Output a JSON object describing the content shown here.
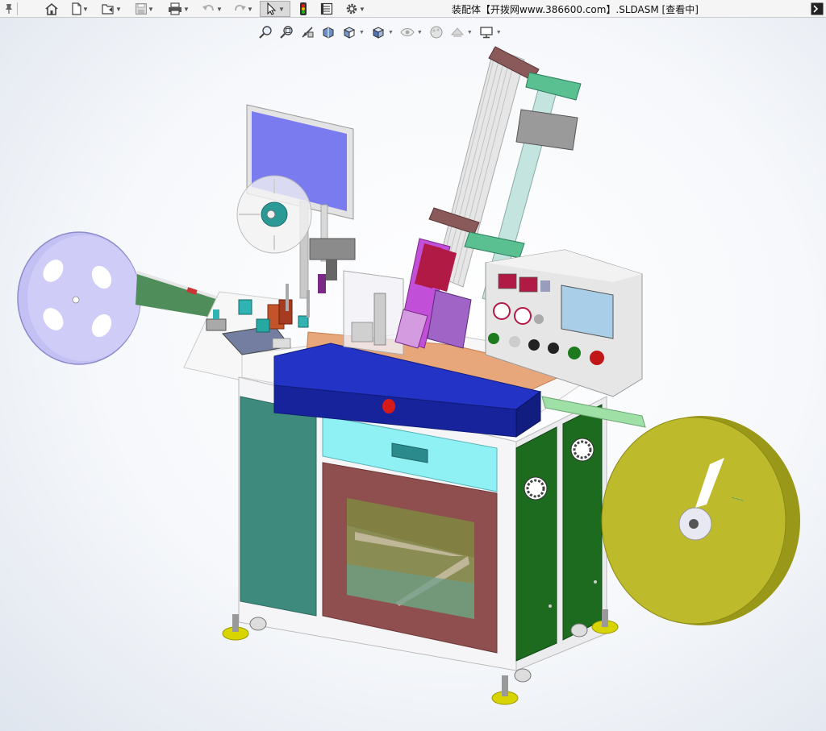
{
  "window": {
    "title": "装配体【开拨网www.386600.com】.SLDASM [查看中]",
    "right_button": ">_"
  },
  "toolbar": {
    "items": [
      {
        "icon": "pin-icon"
      },
      {
        "icon": "home-icon"
      },
      {
        "icon": "new-document-icon"
      },
      {
        "icon": "open-icon"
      },
      {
        "icon": "save-icon"
      },
      {
        "icon": "print-icon"
      },
      {
        "icon": "undo-icon"
      },
      {
        "icon": "redo-icon"
      },
      {
        "icon": "select-pointer-icon"
      },
      {
        "icon": "rebuild-traffic-light-icon"
      },
      {
        "icon": "file-properties-icon"
      },
      {
        "icon": "options-gear-icon"
      }
    ]
  },
  "view_toolbar": {
    "items": [
      {
        "icon": "zoom-to-fit-icon"
      },
      {
        "icon": "zoom-to-area-icon"
      },
      {
        "icon": "previous-view-icon"
      },
      {
        "icon": "section-view-icon"
      },
      {
        "icon": "view-orientation-icon"
      },
      {
        "icon": "display-style-icon"
      },
      {
        "icon": "hide-show-items-icon"
      },
      {
        "icon": "edit-appearance-icon"
      },
      {
        "icon": "apply-scene-icon"
      },
      {
        "icon": "view-settings-monitor-icon"
      }
    ]
  },
  "model": {
    "name": "automatic tape assembly machine",
    "colors": {
      "cabinet_white": "#f4f4f6",
      "door_teal": "#3e8a7c",
      "door_brown": "#8f4f4f",
      "drawer_cyan": "#8ff1f4",
      "side_green": "#1c6b1e",
      "top_blue": "#1b2a9c",
      "reel_left": "#c3c1f4",
      "reel_right": "#bdba2c",
      "monitor_screen": "#7b7bf0",
      "feet_yellow": "#d8d400",
      "orange_plate": "#e8a77a",
      "panel_gray": "#e6e6e6",
      "hmi_screen": "#a9cfe8",
      "magenta": "#c24fd8",
      "crimson": "#b01a45"
    }
  }
}
